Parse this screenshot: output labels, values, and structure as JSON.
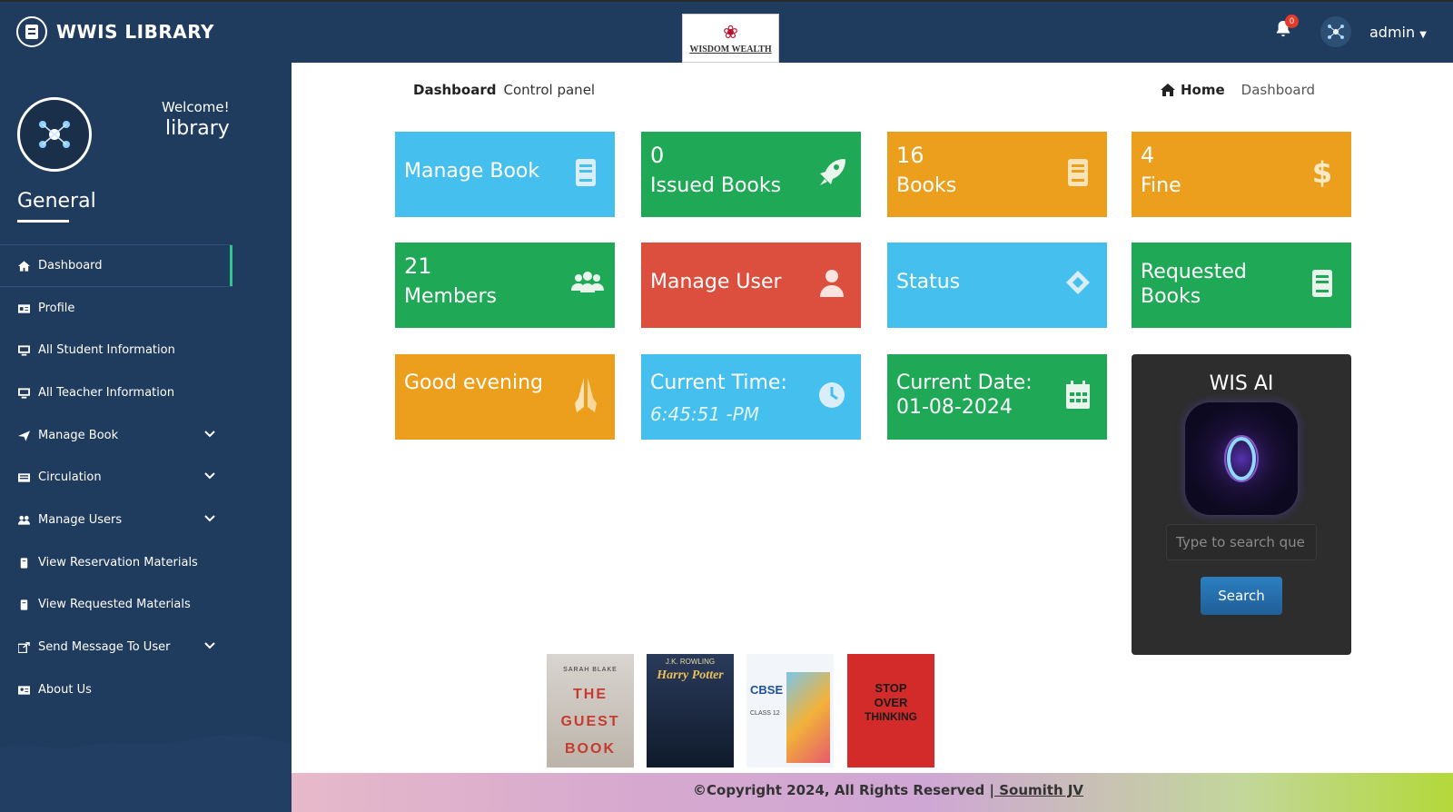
{
  "topbar": {
    "brand_name": "WWIS LIBRARY",
    "logo_text": "WISDOM WEALTH",
    "notification_count": "0",
    "user_menu_label": "admin"
  },
  "sidebar": {
    "welcome": "Welcome!",
    "username": "library",
    "section_title": "General",
    "items": [
      {
        "label": "Dashboard",
        "icon": "home-icon",
        "active": true
      },
      {
        "label": "Profile",
        "icon": "id-card-icon"
      },
      {
        "label": "All Student Information",
        "icon": "monitor-icon"
      },
      {
        "label": "All Teacher Information",
        "icon": "monitor-icon"
      },
      {
        "label": "Manage Book",
        "icon": "send-icon",
        "has_submenu": true
      },
      {
        "label": "Circulation",
        "icon": "list-icon",
        "has_submenu": true
      },
      {
        "label": "Manage Users",
        "icon": "users-icon",
        "has_submenu": true
      },
      {
        "label": "View Reservation Materials",
        "icon": "book-icon"
      },
      {
        "label": "View Requested Materials",
        "icon": "book-icon"
      },
      {
        "label": "Send Message To User",
        "icon": "share-icon",
        "has_submenu": true
      },
      {
        "label": "About Us",
        "icon": "address-card-icon"
      }
    ]
  },
  "header": {
    "page_title": "Dashboard",
    "page_subtitle": "Control panel",
    "breadcrumb_home": "Home",
    "breadcrumb_current": "Dashboard"
  },
  "tiles": {
    "manage_book": {
      "label": "Manage Book",
      "icon": "book-icon",
      "color": "#45bfee"
    },
    "issued_books": {
      "value": "0",
      "label": "Issued Books",
      "icon": "rocket-icon",
      "color": "#1fa855"
    },
    "books": {
      "value": "16",
      "label": "Books",
      "icon": "book-icon",
      "color": "#ec9f1c"
    },
    "fine": {
      "value": "4",
      "label": "Fine",
      "icon": "dollar-icon",
      "color": "#ec9f1c"
    },
    "members": {
      "value": "21",
      "label": "Members",
      "icon": "users-icon",
      "color": "#1fa855"
    },
    "manage_user": {
      "label": "Manage User",
      "icon": "user-icon",
      "color": "#dc4f3e"
    },
    "status": {
      "label": "Status",
      "icon": "layers-icon",
      "color": "#45bfee"
    },
    "requested_books": {
      "label_line1": "Requested",
      "label_line2": "Books",
      "icon": "book-icon",
      "color": "#1fa855"
    },
    "greeting": {
      "label": "Good evening",
      "icon": "praying-hands-icon",
      "color": "#ec9f1c"
    },
    "current_time": {
      "label": "Current Time:",
      "value": "6:45:51 -PM",
      "icon": "clock-icon",
      "color": "#45bfee"
    },
    "current_date": {
      "label": "Current Date:",
      "value": "01-08-2024",
      "icon": "calendar-icon",
      "color": "#1fa855"
    }
  },
  "ai_panel": {
    "title": "WIS AI",
    "input_placeholder": "Type to search que",
    "search_label": "Search"
  },
  "books_shelf": [
    {
      "title_lines": [
        "THE",
        "GUEST",
        "BOOK"
      ],
      "author": "SARAH BLAKE"
    },
    {
      "title": "Harry Potter",
      "author": "J.K. ROWLING"
    },
    {
      "title": "CBSE",
      "subtitle": "CLASS 12"
    },
    {
      "title_lines": [
        "STOP",
        "OVER",
        "THINKING"
      ]
    }
  ],
  "footer": {
    "copyright": "©Copyright 2024, All Rights Reserved |",
    "author_link": " Soumith JV"
  }
}
